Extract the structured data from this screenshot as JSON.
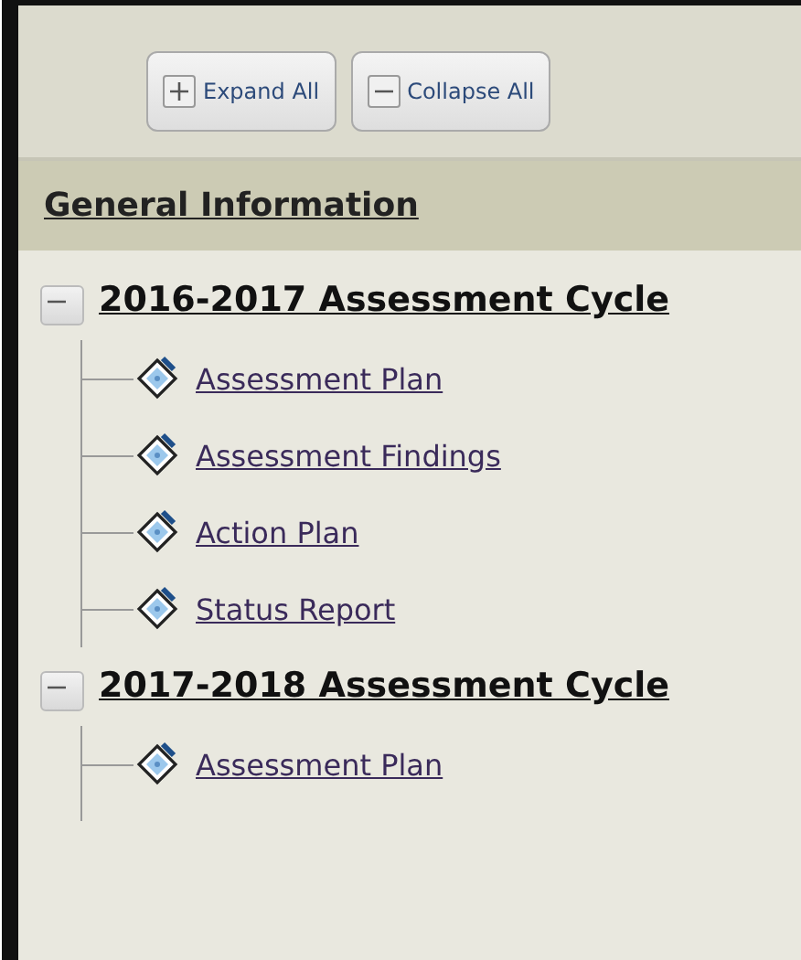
{
  "toolbar": {
    "buttons": [
      {
        "kind": "expand",
        "label": "Expand All"
      },
      {
        "kind": "collapse",
        "label": "Collapse All"
      }
    ]
  },
  "section_header": {
    "title": "General Information"
  },
  "tree": [
    {
      "label": "2016-2017 Assessment Cycle",
      "expanded": true,
      "children": [
        {
          "label": "Assessment Plan"
        },
        {
          "label": "Assessment Findings"
        },
        {
          "label": "Action Plan"
        },
        {
          "label": "Status Report"
        }
      ]
    },
    {
      "label": "2017-2018 Assessment Cycle",
      "expanded": true,
      "children": [
        {
          "label": "Assessment Plan"
        }
      ]
    }
  ]
}
